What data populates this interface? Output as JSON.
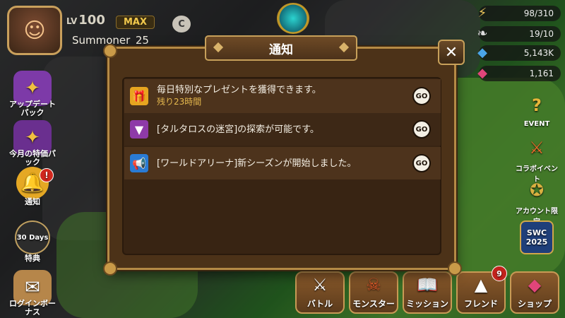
{
  "profile": {
    "level_prefix": "LV",
    "level": "100",
    "max_badge": "MAX",
    "username": "Summoner_25",
    "c_badge": "C"
  },
  "resources": [
    {
      "icon": "energy-icon",
      "value": "98/310"
    },
    {
      "icon": "wing-icon",
      "value": "19/10"
    },
    {
      "icon": "crystal-icon",
      "value": "5,143K"
    },
    {
      "icon": "ruby-icon",
      "value": "1,161"
    }
  ],
  "left_menu": [
    {
      "label": "アップデートパック",
      "icon": "update-pack-icon"
    },
    {
      "label": "今月の特価パック",
      "icon": "monthly-pack-icon"
    },
    {
      "label": "通知",
      "icon": "bell-icon",
      "alert": "!"
    },
    {
      "label": "特典",
      "icon": "30-days-icon",
      "icon_text": "30 Days"
    },
    {
      "label": "ログインボーナス",
      "icon": "login-bonus-icon"
    }
  ],
  "right_menu": [
    {
      "label": "EVENT",
      "icon": "event-icon",
      "tag": "E"
    },
    {
      "label": "コラボイベント",
      "icon": "collab-event-icon"
    },
    {
      "label": "アカウント限定",
      "icon": "account-limited-icon"
    },
    {
      "label": "SWC 2025",
      "icon": "swc-icon"
    }
  ],
  "bottom_menu": [
    {
      "label": "バトル",
      "icon": "battle-swords-icon"
    },
    {
      "label": "モンスター",
      "icon": "monster-icon"
    },
    {
      "label": "ミッション",
      "icon": "mission-book-icon"
    },
    {
      "label": "フレンド",
      "icon": "friend-hat-icon",
      "badge": "9"
    },
    {
      "label": "ショップ",
      "icon": "shop-crystal-icon"
    }
  ],
  "dialog": {
    "title": "通知",
    "close_label": "✕",
    "notifications": [
      {
        "icon": "gift-icon",
        "icon_color": "#e7a520",
        "text": "毎日特別なプレゼントを獲得できます。",
        "sub": "残り23時間",
        "go": "GO"
      },
      {
        "icon": "chevron-down-icon",
        "icon_color": "#8e3aa8",
        "text": "[タルタロスの迷宮]の探索が可能です。",
        "sub": "",
        "go": "GO"
      },
      {
        "icon": "megaphone-icon",
        "icon_color": "#2a7bd4",
        "text": "[ワールドアリーナ]新シーズンが開始しました。",
        "sub": "",
        "go": "GO"
      }
    ]
  }
}
